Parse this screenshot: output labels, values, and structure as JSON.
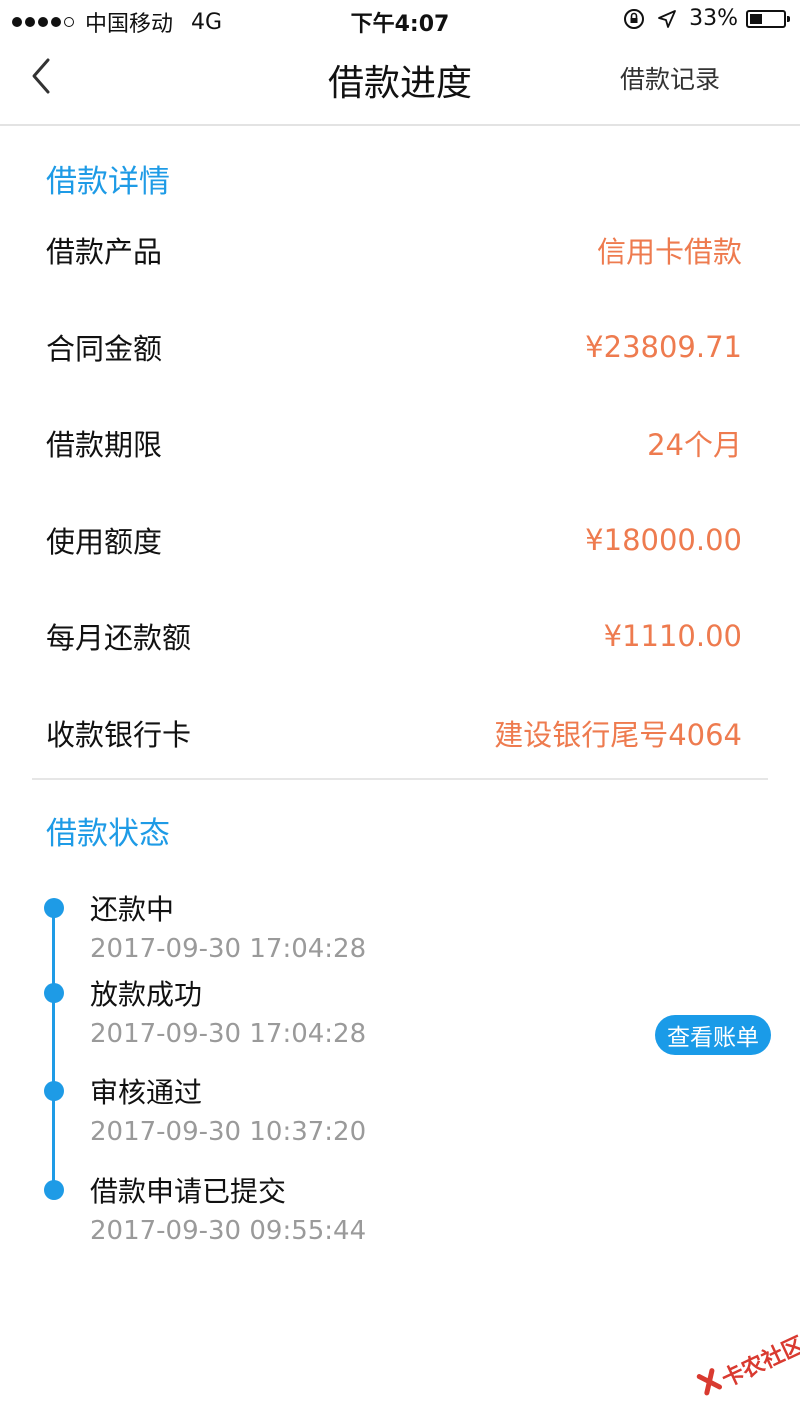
{
  "status_bar": {
    "carrier": "中国移动",
    "network": "4G",
    "time": "下午4:07",
    "battery": "33%"
  },
  "nav": {
    "title": "借款进度",
    "right_link": "借款记录"
  },
  "details": {
    "title": "借款详情",
    "rows": [
      {
        "label": "借款产品",
        "value": "信用卡借款"
      },
      {
        "label": "合同金额",
        "value": "¥23809.71"
      },
      {
        "label": "借款期限",
        "value": "24个月"
      },
      {
        "label": "使用额度",
        "value": "¥18000.00"
      },
      {
        "label": "每月还款额",
        "value": "¥1110.00"
      },
      {
        "label": "收款银行卡",
        "value": "建设银行尾号4064"
      }
    ]
  },
  "status": {
    "title": "借款状态",
    "items": [
      {
        "label": "还款中",
        "time": "2017-09-30 17:04:28"
      },
      {
        "label": "放款成功",
        "time": "2017-09-30 17:04:28"
      },
      {
        "label": "审核通过",
        "time": "2017-09-30 10:37:20"
      },
      {
        "label": "借款申请已提交",
        "time": "2017-09-30 09:55:44"
      }
    ],
    "view_bill_label": "查看账单"
  },
  "watermark": {
    "text": "卡农社区"
  },
  "colors": {
    "accent_blue": "#1e9be6",
    "value_orange": "#ee7b4f"
  }
}
